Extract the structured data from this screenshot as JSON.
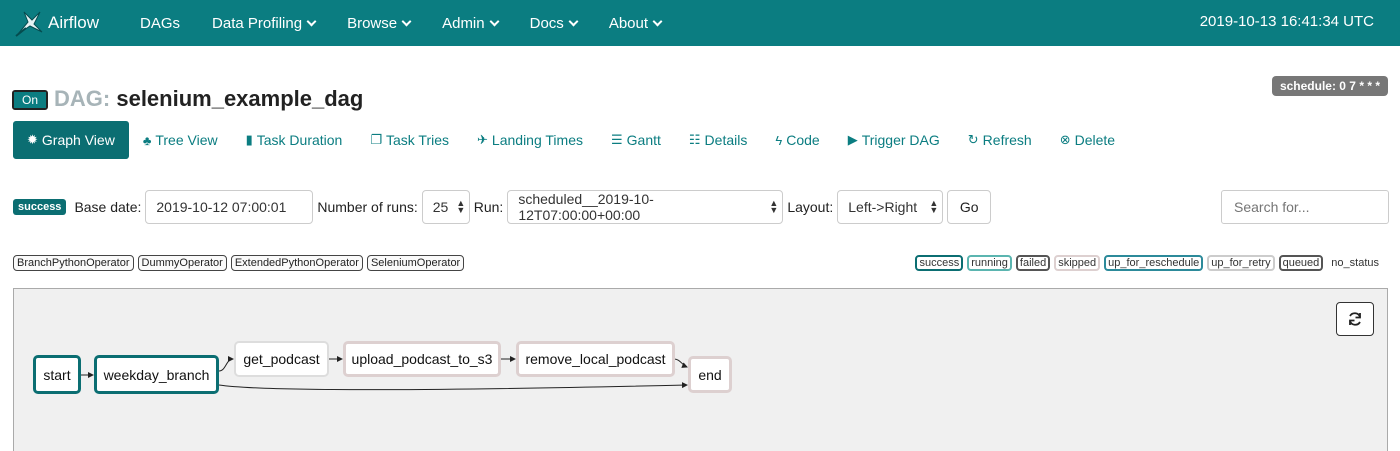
{
  "nav": {
    "brand": "Airflow",
    "items": [
      {
        "label": "DAGs",
        "dropdown": false
      },
      {
        "label": "Data Profiling",
        "dropdown": true
      },
      {
        "label": "Browse",
        "dropdown": true
      },
      {
        "label": "Admin",
        "dropdown": true
      },
      {
        "label": "Docs",
        "dropdown": true
      },
      {
        "label": "About",
        "dropdown": true
      }
    ],
    "datetime": "2019-10-13 16:41:34 UTC"
  },
  "header": {
    "toggle_label": "On",
    "dag_prefix": "DAG:",
    "dag_name": "selenium_example_dag",
    "schedule": "schedule: 0 7 * * *"
  },
  "tabs": [
    {
      "label": "Graph View",
      "icon": "asterisk-icon",
      "active": true
    },
    {
      "label": "Tree View",
      "icon": "tree-icon",
      "active": false
    },
    {
      "label": "Task Duration",
      "icon": "bar-chart-icon",
      "active": false
    },
    {
      "label": "Task Tries",
      "icon": "duplicate-icon",
      "active": false
    },
    {
      "label": "Landing Times",
      "icon": "plane-icon",
      "active": false
    },
    {
      "label": "Gantt",
      "icon": "align-left-icon",
      "active": false
    },
    {
      "label": "Details",
      "icon": "list-icon",
      "active": false
    },
    {
      "label": "Code",
      "icon": "flash-icon",
      "active": false
    },
    {
      "label": "Trigger DAG",
      "icon": "play-circle-icon",
      "active": false
    },
    {
      "label": "Refresh",
      "icon": "refresh-icon",
      "active": false
    },
    {
      "label": "Delete",
      "icon": "remove-circle-icon",
      "active": false
    }
  ],
  "form": {
    "status_badge": "success",
    "base_date_label": "Base date:",
    "base_date_value": "2019-10-12 07:00:01",
    "num_runs_label": "Number of runs:",
    "num_runs_value": "25",
    "run_label": "Run:",
    "run_value": "scheduled__2019-10-12T07:00:00+00:00",
    "layout_label": "Layout:",
    "layout_value": "Left->Right",
    "go_label": "Go",
    "search_placeholder": "Search for..."
  },
  "operators": [
    "BranchPythonOperator",
    "DummyOperator",
    "ExtendedPythonOperator",
    "SeleniumOperator"
  ],
  "states": [
    {
      "label": "success",
      "color": "#0b6e72"
    },
    {
      "label": "running",
      "color": "#5bb5b0"
    },
    {
      "label": "failed",
      "color": "#555555"
    },
    {
      "label": "skipped",
      "color": "#ddd0d0"
    },
    {
      "label": "up_for_reschedule",
      "color": "#2c8a9a"
    },
    {
      "label": "up_for_retry",
      "color": "#cccccc"
    },
    {
      "label": "queued",
      "color": "#555555"
    },
    {
      "label": "no_status",
      "color": ""
    }
  ],
  "graph": {
    "nodes": [
      {
        "id": "start",
        "label": "start",
        "state": "success"
      },
      {
        "id": "weekday_branch",
        "label": "weekday_branch",
        "state": "success"
      },
      {
        "id": "get_podcast",
        "label": "get_podcast",
        "state": "none"
      },
      {
        "id": "upload_podcast_to_s3",
        "label": "upload_podcast_to_s3",
        "state": "skipped"
      },
      {
        "id": "remove_local_podcast",
        "label": "remove_local_podcast",
        "state": "skipped"
      },
      {
        "id": "end",
        "label": "end",
        "state": "skipped"
      }
    ]
  }
}
